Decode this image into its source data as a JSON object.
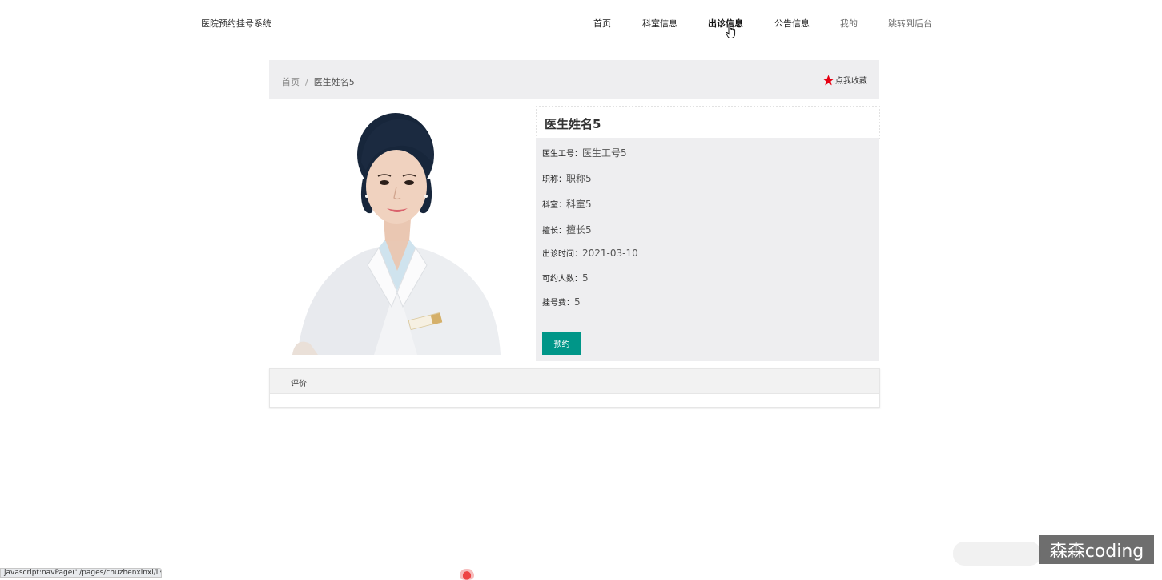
{
  "header": {
    "site_title": "医院预约挂号系统",
    "nav": [
      {
        "label": "首页"
      },
      {
        "label": "科室信息"
      },
      {
        "label": "出诊信息"
      },
      {
        "label": "公告信息"
      },
      {
        "label": "我的"
      },
      {
        "label": "跳转到后台"
      }
    ]
  },
  "breadcrumb": {
    "home": "首页",
    "separator": "/",
    "current": "医生姓名5"
  },
  "favorite": {
    "label": "点我收藏",
    "icon": "star-icon",
    "color": "#e60012"
  },
  "doctor": {
    "name": "医生姓名5",
    "fields": [
      {
        "label": "医生工号：",
        "value": "医生工号5"
      },
      {
        "label": "职称：",
        "value": "职称5"
      },
      {
        "label": "科室：",
        "value": "科室5"
      },
      {
        "label": "擅长：",
        "value": "擅长5"
      },
      {
        "label": "出诊时间：",
        "value": "2021-03-10"
      },
      {
        "label": "可约人数：",
        "value": "5"
      },
      {
        "label": "挂号费：",
        "value": "5"
      }
    ],
    "book_button": "预约",
    "accent_color": "#009688"
  },
  "comments": {
    "title": "评价"
  },
  "status_bar": {
    "url": "javascript:navPage('./pages/chuzhenxinxi/list.jsp')"
  },
  "watermark": {
    "text": "森森coding"
  }
}
